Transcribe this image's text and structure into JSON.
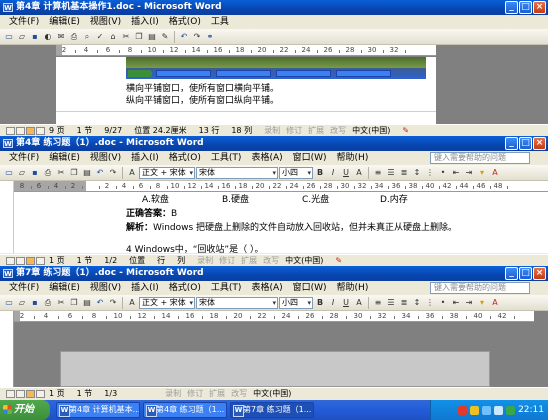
{
  "windows": [
    {
      "title": "第4章 计算机基本操作1.doc - Microsoft Word",
      "menu": [
        "文件(F)",
        "编辑(E)",
        "视图(V)",
        "插入(I)",
        "格式(O)",
        "工具"
      ],
      "help_placeholder": "",
      "ruler": [
        "2",
        "4",
        "6",
        "8",
        "10",
        "12",
        "14",
        "16",
        "18",
        "20",
        "22",
        "24",
        "26",
        "28",
        "30",
        "32"
      ],
      "lines": [
        "横向平铺窗口，使所有窗口横向平铺。",
        "纵向平铺窗口，使所有窗口纵向平铺。"
      ],
      "status": {
        "page": "9 页",
        "section": "1 节",
        "of": "9/27",
        "pos": "位置 24.2厘米",
        "line": "13 行",
        "col": "18 列",
        "rec": "录制",
        "trk": "修订",
        "ext": "扩展",
        "ovr": "改写",
        "lang": "中文(中国)"
      }
    },
    {
      "title": "第4章 练习题（1）.doc - Microsoft Word",
      "menu": [
        "文件(F)",
        "编辑(E)",
        "视图(V)",
        "插入(I)",
        "格式(O)",
        "工具(T)",
        "表格(A)",
        "窗口(W)",
        "帮助(H)"
      ],
      "help_placeholder": "键入需要帮助的问题",
      "style": "正文 + 宋体",
      "font": "宋体",
      "size": "小四",
      "ruler": [
        "8",
        "6",
        "4",
        "2",
        "",
        "2",
        "4",
        "6",
        "8",
        "10",
        "12",
        "14",
        "16",
        "18",
        "20",
        "22",
        "24",
        "26",
        "28",
        "30",
        "32",
        "34",
        "36",
        "38",
        "40",
        "42",
        "44",
        "46",
        "48"
      ],
      "options": [
        "A.软盘",
        "B.硬盘",
        "C.光盘",
        "D.内存"
      ],
      "answer_label": "正确答案：",
      "answer_value": "B",
      "analysis_label": "解析：",
      "analysis_text": "Windows 把硬盘上删除的文件自动放入回收站，但并未真正从硬盘上删除。",
      "next_question": "4 Windows中，“回收站”是（  ）。",
      "status": {
        "page": "1 页",
        "section": "1 节",
        "of": "1/2",
        "pos": "位置",
        "line": "行",
        "col": "列",
        "rec": "录制",
        "trk": "修订",
        "ext": "扩展",
        "ovr": "改写",
        "lang": "中文(中国)"
      }
    },
    {
      "title": "第7章 练习题（1）.doc - Microsoft Word",
      "menu": [
        "文件(F)",
        "编辑(E)",
        "视图(V)",
        "插入(I)",
        "格式(O)",
        "工具(T)",
        "表格(A)",
        "窗口(W)",
        "帮助(H)"
      ],
      "help_placeholder": "键入需要帮助的问题",
      "style": "正文 + 宋体",
      "font": "宋体",
      "size": "小四",
      "ruler": [
        "2",
        "4",
        "6",
        "8",
        "10",
        "12",
        "14",
        "16",
        "18",
        "20",
        "22",
        "24",
        "26",
        "28",
        "30",
        "32",
        "34",
        "36",
        "38",
        "40",
        "42"
      ],
      "status": {
        "page": "1 页",
        "section": "1 节",
        "of": "1/3",
        "pos": "",
        "line": "",
        "col": "",
        "rec": "录制",
        "trk": "修订",
        "ext": "扩展",
        "ovr": "改写",
        "lang": "中文(中国)"
      }
    }
  ],
  "taskbar": {
    "start": "开始",
    "tasks": [
      "第4章 计算机基本...",
      "第4章 练习题（1...",
      "第7章 练习题（1..."
    ],
    "clock": "22:11"
  },
  "colors": {
    "title_blue": "#0846b0",
    "taskbar_blue": "#245edb",
    "start_green": "#3c8f3a"
  }
}
